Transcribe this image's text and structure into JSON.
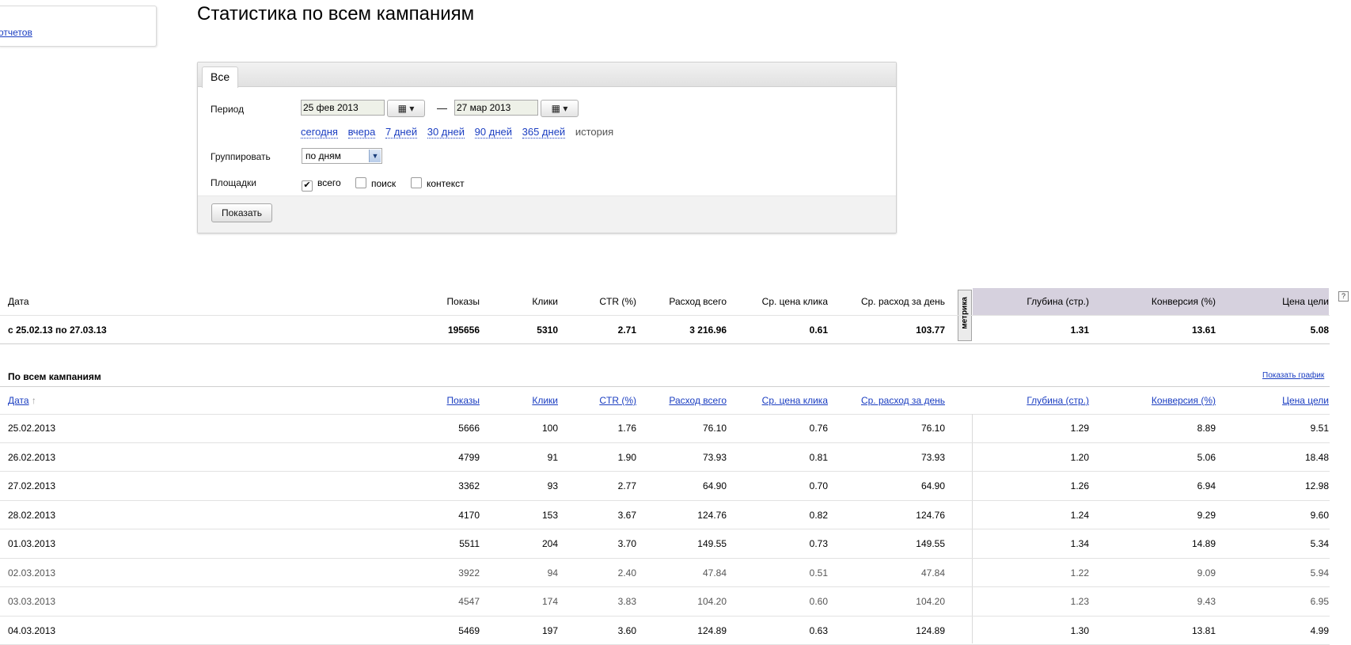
{
  "sidebar": {
    "link": "отчетов"
  },
  "title": "Статистика по всем кампаниям",
  "filter": {
    "tab": "Все",
    "period_label": "Период",
    "date_from": "25 фев 2013",
    "date_to": "27 мар 2013",
    "dash": "—",
    "quick_links": [
      "сегодня",
      "вчера",
      "7 дней",
      "30 дней",
      "90 дней",
      "365 дней"
    ],
    "history": "история",
    "group_label": "Группировать",
    "group_value": "по дням",
    "platforms_label": "Площадки",
    "platforms": [
      {
        "label": "всего",
        "checked": true
      },
      {
        "label": "поиск",
        "checked": false
      },
      {
        "label": "контекст",
        "checked": false
      }
    ],
    "show_button": "Показать"
  },
  "summary": {
    "headers": [
      "Дата",
      "Показы",
      "Клики",
      "CTR (%)",
      "Расход всего",
      "Ср. цена клика",
      "Ср. расход за день",
      "Глубина (стр.)",
      "Конверсия (%)",
      "Цена цели"
    ],
    "metrika": "метрика",
    "help": "?",
    "row": [
      "с 25.02.13 по 27.03.13",
      "195656",
      "5310",
      "2.71",
      "3 216.96",
      "0.61",
      "103.77",
      "1.31",
      "13.61",
      "5.08"
    ]
  },
  "detail": {
    "section_title": "По всем кампаниям",
    "show_chart": "Показать график",
    "sort_arrow": "↑",
    "headers": [
      "Дата",
      "Показы",
      "Клики",
      "CTR (%)",
      "Расход всего",
      "Ср. цена клика",
      "Ср. расход за день",
      "Глубина (стр.)",
      "Конверсия (%)",
      "Цена цели"
    ],
    "rows": [
      [
        "25.02.2013",
        "5666",
        "100",
        "1.76",
        "76.10",
        "0.76",
        "76.10",
        "1.29",
        "8.89",
        "9.51"
      ],
      [
        "26.02.2013",
        "4799",
        "91",
        "1.90",
        "73.93",
        "0.81",
        "73.93",
        "1.20",
        "5.06",
        "18.48"
      ],
      [
        "27.02.2013",
        "3362",
        "93",
        "2.77",
        "64.90",
        "0.70",
        "64.90",
        "1.26",
        "6.94",
        "12.98"
      ],
      [
        "28.02.2013",
        "4170",
        "153",
        "3.67",
        "124.76",
        "0.82",
        "124.76",
        "1.24",
        "9.29",
        "9.60"
      ],
      [
        "01.03.2013",
        "5511",
        "204",
        "3.70",
        "149.55",
        "0.73",
        "149.55",
        "1.34",
        "14.89",
        "5.34"
      ],
      [
        "02.03.2013",
        "3922",
        "94",
        "2.40",
        "47.84",
        "0.51",
        "47.84",
        "1.22",
        "9.09",
        "5.94"
      ],
      [
        "03.03.2013",
        "4547",
        "174",
        "3.83",
        "104.20",
        "0.60",
        "104.20",
        "1.23",
        "9.43",
        "6.95"
      ],
      [
        "04.03.2013",
        "5469",
        "197",
        "3.60",
        "124.89",
        "0.63",
        "124.89",
        "1.30",
        "13.81",
        "4.99"
      ]
    ]
  }
}
